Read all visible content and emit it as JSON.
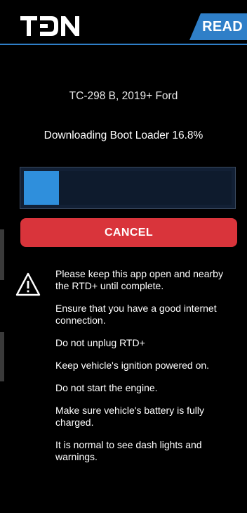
{
  "header": {
    "logo_text": "TDN",
    "tab_label": "READ",
    "accent_color": "#2f7fc8"
  },
  "device": {
    "name": "TC-298 B, 2019+ Ford"
  },
  "download": {
    "status_text": "Downloading Boot Loader 16.8%",
    "progress_percent": 16.8
  },
  "cancel_button": {
    "label": "CANCEL",
    "color": "#d9343b"
  },
  "warning": {
    "icon": "warning-triangle-icon",
    "instructions": [
      "Please keep this app open and nearby the RTD+ until complete.",
      "Ensure that you have a good internet connection.",
      "Do not unplug RTD+",
      "Keep vehicle's ignition powered on.",
      "Do not start the engine.",
      "Make sure vehicle's battery is fully charged.",
      "It is normal to see dash lights and warnings."
    ]
  }
}
